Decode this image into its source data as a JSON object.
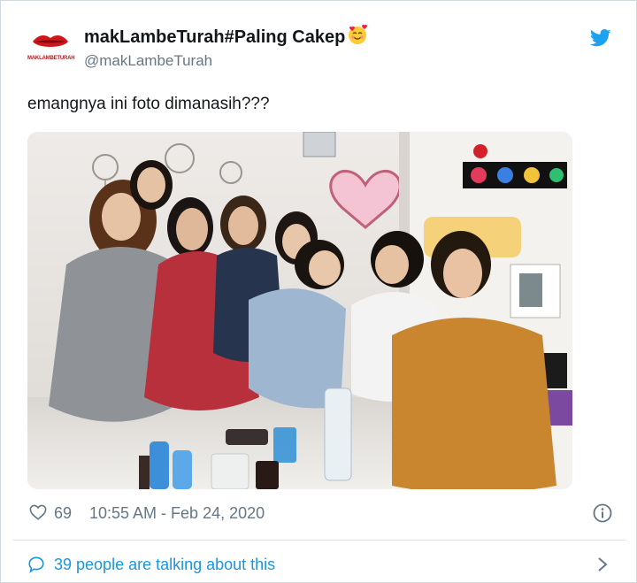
{
  "author": {
    "display_name": "makLambeTurah#Paling Cakep",
    "handle": "@makLambeTurah",
    "logo_text": "MAKLAMBETURAH",
    "emoji_icon": "smiling-face-with-hearts-icon"
  },
  "tweet": {
    "text": "emangnya ini foto dimanasih???"
  },
  "meta": {
    "like_count": "69",
    "timestamp": "10:55 AM - Feb 24, 2020"
  },
  "footer": {
    "talking_label": "39 people are talking about this"
  },
  "colors": {
    "text": "#14171a",
    "secondary": "#657786",
    "twitter_blue": "#1b95e0",
    "logo_red": "#c4161c"
  }
}
